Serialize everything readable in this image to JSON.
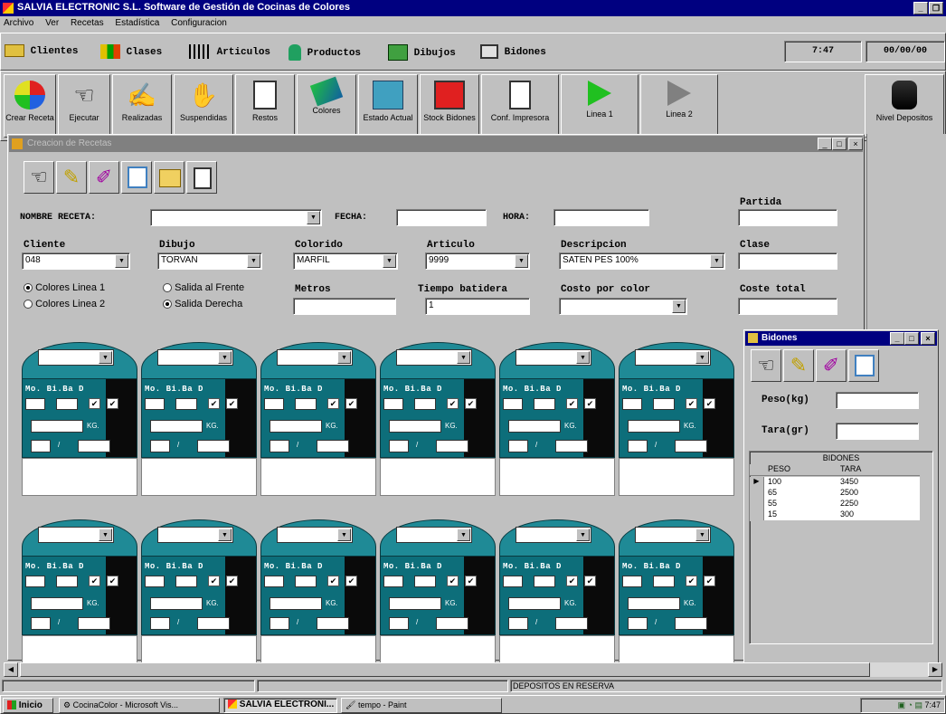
{
  "app": {
    "title": "SALVIA ELECTRONIC S.L.  Software de Gestión de Cocinas de Colores",
    "menu": [
      "Archivo",
      "Ver",
      "Recetas",
      "Estadística",
      "Configuracion"
    ]
  },
  "nav": {
    "items": [
      "Clientes",
      "Clases",
      "Articulos",
      "Productos",
      "Dibujos",
      "Bidones"
    ],
    "time": "7:47",
    "date": "00/00/00"
  },
  "toolbar": {
    "buttons": [
      "Crear Receta",
      "Ejecutar",
      "Realizadas",
      "Suspendidas",
      "Restos",
      "Colores",
      "Estado Actual",
      "Stock Bidones",
      "Conf. Impresora",
      "Linea 1",
      "Linea 2",
      "Nivel Depositos"
    ]
  },
  "recetas_window": {
    "title": "Creacion de Recetas",
    "labels": {
      "nombre": "NOMBRE RECETA:",
      "fecha": "FECHA:",
      "hora": "HORA:",
      "partida": "Partida",
      "cliente": "Cliente",
      "dibujo": "Dibujo",
      "colorido": "Colorido",
      "articulo": "Articulo",
      "descripcion": "Descripcion",
      "clase": "Clase",
      "metros": "Metros",
      "tiempo": "Tiempo batidera",
      "costo_color": "Costo por color",
      "coste_total": "Coste total"
    },
    "values": {
      "cliente": "048",
      "dibujo": "TORVAN",
      "colorido": "MARFIL",
      "articulo": "9999",
      "descripcion": "SATEN PES 100%",
      "tiempo": "1"
    },
    "radios": {
      "colores_l1": "Colores Linea 1",
      "colores_l2": "Colores Linea 2",
      "salida_frente": "Salida al Frente",
      "salida_derecha": "Salida Derecha"
    },
    "tank": {
      "header": "Mo. Bi.Ba D",
      "kg": "KG."
    }
  },
  "bidones_window": {
    "title": "Bidones",
    "peso_label": "Peso(kg)",
    "tara_label": "Tara(gr)",
    "grid_title": "BIDONES",
    "columns": [
      "PESO",
      "TARA"
    ],
    "rows": [
      [
        "100",
        "3450"
      ],
      [
        "65",
        "2500"
      ],
      [
        "55",
        "2250"
      ],
      [
        "15",
        "300"
      ]
    ]
  },
  "status": {
    "text": "DEPOSITOS EN RESERVA"
  },
  "taskbar": {
    "start": "Inicio",
    "tasks": [
      "CocinaColor - Microsoft Vis...",
      "SALVIA ELECTRONI...",
      "tempo - Paint"
    ],
    "clock": "7:47"
  }
}
